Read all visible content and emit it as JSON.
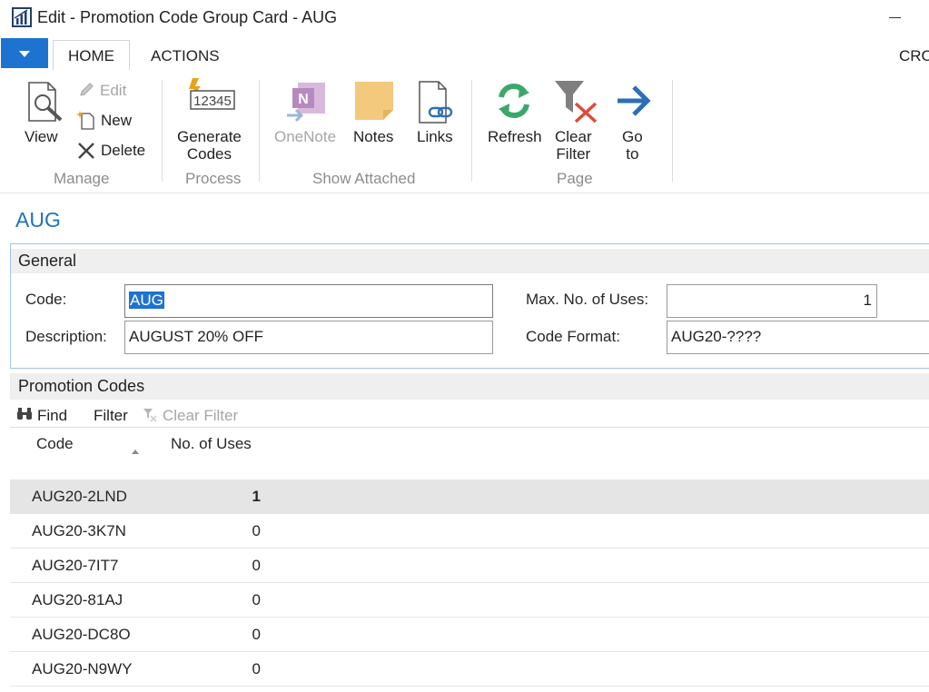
{
  "window": {
    "title": "Edit - Promotion Code Group Card - AUG"
  },
  "tabs": [
    {
      "label": "HOME",
      "selected": true
    },
    {
      "label": "ACTIONS",
      "selected": false
    },
    {
      "label": "CRO",
      "selected": false
    }
  ],
  "ribbon": {
    "manage": {
      "label": "Manage",
      "view": "View",
      "edit": "Edit",
      "new": "New",
      "delete": "Delete"
    },
    "process": {
      "label": "Process",
      "generate_line1": "Generate",
      "generate_line2": "Codes",
      "icon_text": "12345"
    },
    "show_attached": {
      "label": "Show Attached",
      "onenote": "OneNote",
      "notes": "Notes",
      "links": "Links"
    },
    "page": {
      "label": "Page",
      "refresh": "Refresh",
      "clear_filter_line1": "Clear",
      "clear_filter_line2": "Filter",
      "goto_line1": "Go",
      "goto_line2": "to"
    }
  },
  "record": {
    "title": "AUG"
  },
  "general": {
    "title": "General",
    "code_label": "Code:",
    "code_value": "AUG",
    "description_label": "Description:",
    "description_value": "AUGUST 20% OFF",
    "max_uses_label": "Max. No. of Uses:",
    "max_uses_value": "1",
    "code_format_label": "Code Format:",
    "code_format_value": "AUG20-????"
  },
  "promotion_codes": {
    "title": "Promotion Codes",
    "toolbar": {
      "find": "Find",
      "filter": "Filter",
      "clear_filter": "Clear Filter"
    },
    "columns": {
      "code": "Code",
      "uses": "No. of Uses"
    },
    "rows": [
      {
        "code": "AUG20-2LND",
        "uses": "1"
      },
      {
        "code": "AUG20-3K7N",
        "uses": "0"
      },
      {
        "code": "AUG20-7IT7",
        "uses": "0"
      },
      {
        "code": "AUG20-81AJ",
        "uses": "0"
      },
      {
        "code": "AUG20-DC8O",
        "uses": "0"
      },
      {
        "code": "AUG20-N9WY",
        "uses": "0"
      }
    ]
  },
  "colors": {
    "accent": "#1e73d1",
    "title_blue": "#1e73be",
    "selected_row": "#e5e5e5"
  }
}
